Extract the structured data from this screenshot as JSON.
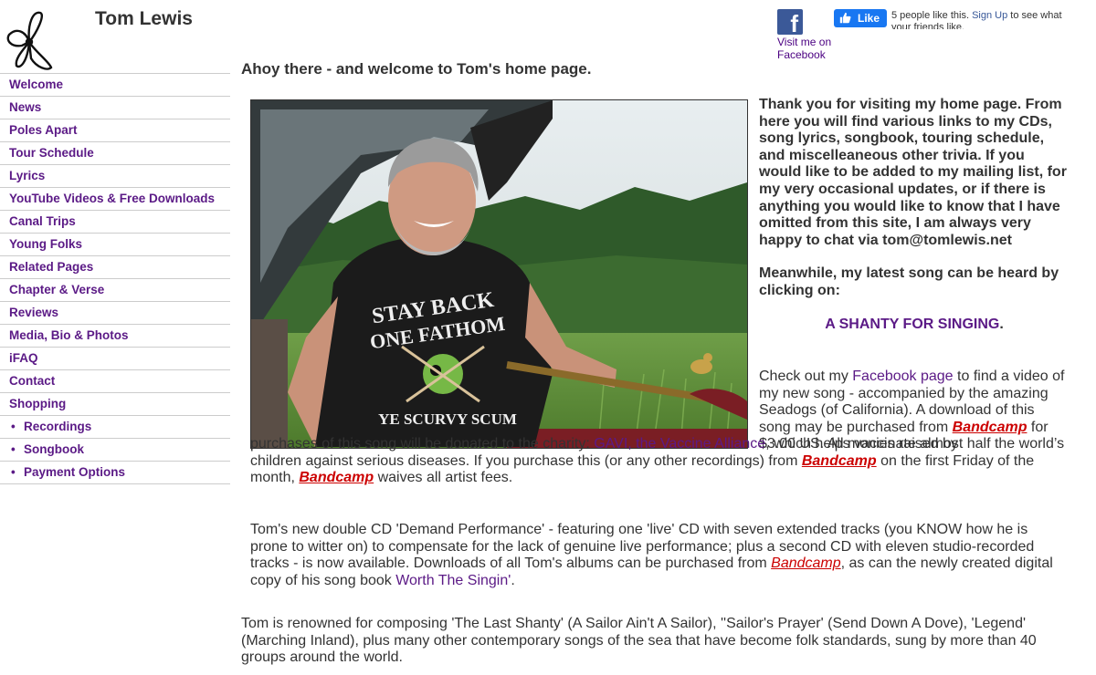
{
  "site": {
    "title": "Tom Lewis"
  },
  "facebook": {
    "visit_text": "Visit me on Facebook",
    "like_label": "Like",
    "like_text_pre": "5 people like this.",
    "like_signup": "Sign Up",
    "like_text_post": "to see what",
    "like_text_line2": "your friends like."
  },
  "nav": {
    "items": [
      {
        "label": "Welcome"
      },
      {
        "label": "News"
      },
      {
        "label": "Poles Apart"
      },
      {
        "label": "Tour Schedule"
      },
      {
        "label": "Lyrics"
      },
      {
        "label": "YouTube Videos & Free Downloads"
      },
      {
        "label": "Canal Trips"
      },
      {
        "label": "Young Folks"
      },
      {
        "label": "Related Pages"
      },
      {
        "label": "Chapter & Verse"
      },
      {
        "label": "Reviews"
      },
      {
        "label": "Media, Bio & Photos"
      },
      {
        "label": "iFAQ"
      },
      {
        "label": "Contact"
      },
      {
        "label": "Shopping"
      },
      {
        "label": "Recordings",
        "bullet": "•"
      },
      {
        "label": "Songbook",
        "bullet": "•"
      },
      {
        "label": "Payment Options",
        "bullet": "•"
      }
    ]
  },
  "main": {
    "welcome": "Ahoy there - and welcome to Tom's home page.",
    "photo_shirt": {
      "line1": "STAY BACK",
      "line2": "ONE FATHOM",
      "line3": "YE SCURVY SCUM"
    },
    "intro": "Thank you for visiting my home page. From here you will find various links to my CDs, song lyrics, songbook, touring schedule, and miscelleaneous other trivia. If you would like to be added to my mailing list, for my very occasional updates, or if there is anything you would like to know that I have omitted from this site, I am always very happy to chat via tom@tomlewis.net",
    "meanwhile": "Meanwhile, my latest song can be heard by clicking on:",
    "shanty_link": "A SHANTY FOR SINGING",
    "shanty_period": ".",
    "checkout": {
      "t1": "Check out my ",
      "facebook_link": "Facebook page",
      "t2": " to find a video of my new song - accompanied by the amazing Seadogs (of California). A download of this song may be purchased from ",
      "bandcamp1": "Bandcamp",
      "t3": " for $3.00 US. All monies raised by",
      "t4": "purchases of this song will be donated to the charity: ",
      "gavi_link": "GAVI, the Vaccine Alliance",
      "t5": ", which helps vaccinate almost half the world’s children against serious diseases. If you purchase this (or any other recordings) from ",
      "bandcamp2": "Bandcamp",
      "t6": " on the first Friday of the month, ",
      "bandcamp3": "Bandcamp",
      "t7": " waives all artist fees."
    },
    "cd_para": {
      "t1": "Tom's new double CD 'Demand Performance'  - featuring one 'live' CD with seven extended tracks (you KNOW how he is prone to witter on) to compensate for the lack of genuine live performance; plus a second CD with eleven studio-recorded tracks - is now available. Downloads of all Tom's albums can be purchased from ",
      "bandcamp": "Bandcamp",
      "t2": ", as can the newly created digital copy of his song book ",
      "songbook_link": "Worth The Singin'",
      "t3": "."
    },
    "renowned": "Tom is renowned for composing 'The Last Shanty' (A Sailor Ain't A Sailor), ''Sailor's Prayer' (Send Down A Dove), 'Legend' (Marching Inland), plus many other contemporary songs of the sea that have become folk standards, sung by more than 40 groups around the world."
  }
}
